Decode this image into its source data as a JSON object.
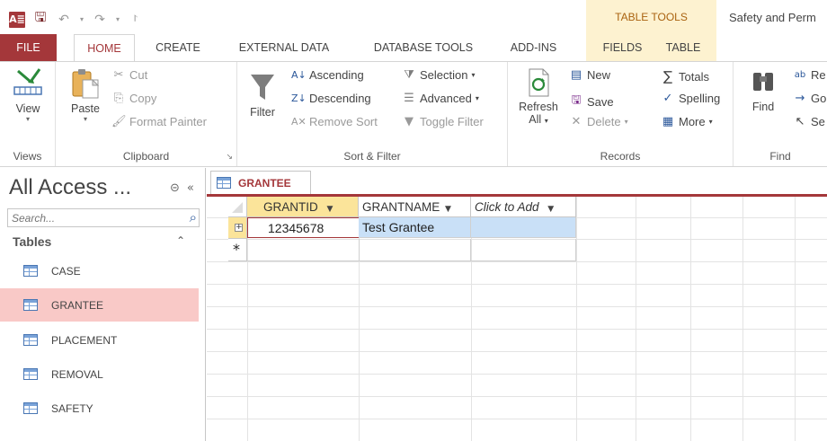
{
  "titlebar": {
    "app_logo": "A≣",
    "qat_icons": [
      "save-icon",
      "undo-icon",
      "redo-icon",
      "customize-qat-icon"
    ],
    "context_group": "TABLE TOOLS",
    "window_title": "Safety and Perm"
  },
  "tabs": {
    "file": "FILE",
    "home": "HOME",
    "create": "CREATE",
    "external_data": "EXTERNAL DATA",
    "database_tools": "DATABASE TOOLS",
    "add_ins": "ADD-INS",
    "fields": "FIELDS",
    "table": "TABLE"
  },
  "ribbon": {
    "views": {
      "label": "Views",
      "view": "View"
    },
    "clipboard": {
      "label": "Clipboard",
      "paste": "Paste",
      "cut": "Cut",
      "copy": "Copy",
      "format_painter": "Format Painter"
    },
    "sort_filter": {
      "label": "Sort & Filter",
      "filter": "Filter",
      "ascending": "Ascending",
      "descending": "Descending",
      "remove_sort": "Remove Sort",
      "selection": "Selection",
      "advanced": "Advanced",
      "toggle_filter": "Toggle Filter"
    },
    "records": {
      "label": "Records",
      "refresh": "Refresh",
      "refresh_all": "All",
      "new": "New",
      "save": "Save",
      "delete": "Delete",
      "totals": "Totals",
      "spelling": "Spelling",
      "more": "More"
    },
    "find": {
      "label": "Find",
      "find": "Find",
      "replace": "Re",
      "goto": "Go",
      "select": "Se"
    }
  },
  "nav": {
    "title": "All Access ...",
    "search_placeholder": "Search...",
    "group": "Tables",
    "items": [
      {
        "label": "CASE",
        "selected": false
      },
      {
        "label": "GRANTEE",
        "selected": true
      },
      {
        "label": "PLACEMENT",
        "selected": false
      },
      {
        "label": "REMOVAL",
        "selected": false
      },
      {
        "label": "SAFETY",
        "selected": false
      }
    ]
  },
  "document": {
    "tab_label": "GRANTEE",
    "columns": [
      "GRANTID",
      "GRANTNAME",
      "Click to Add"
    ],
    "rows": [
      {
        "GRANTID": "12345678",
        "GRANTNAME": "Test Grantee"
      }
    ],
    "new_row_marker": "*"
  },
  "colors": {
    "access_accent": "#a4373a",
    "table_tools": "#fdf2d0",
    "selected_header": "#fbe49a",
    "selected_nav": "#f9c9c7",
    "cell_highlight": "#c9e0f7"
  }
}
